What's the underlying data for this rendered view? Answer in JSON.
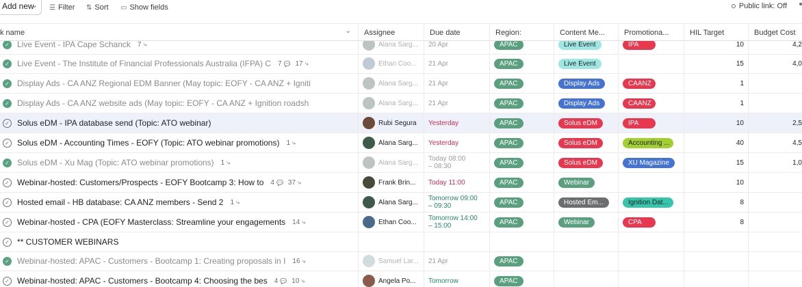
{
  "toolbar": {
    "add_new": "Add new",
    "filter": "Filter",
    "sort": "Sort",
    "show_fields": "Show fields",
    "public_link": "Public link: Off"
  },
  "columns": {
    "task_name": "k name",
    "assignee": "Assignee",
    "due_date": "Due date",
    "region": "Region:",
    "content": "Content Me...",
    "promotional": "Promotiona...",
    "hil": "HIL Target",
    "budget": "Budget Cost"
  },
  "rows": [
    {
      "name": "Live Event - IPA Cape Schanck",
      "done": true,
      "subtasks": "7",
      "comments": "",
      "assignee": "Alana Sarg...",
      "due": "20 Apr",
      "region": "APAC",
      "content": "Live Event",
      "promo": "IPA",
      "hil": "10",
      "budget": "4,2"
    },
    {
      "name": "Live Event - The Institute of Financial Professionals Australia (IFPA) C",
      "done": true,
      "comments": "7",
      "subtasks": "17",
      "assignee": "Ethan Coo...",
      "due": "21 Apr",
      "region": "APAC",
      "content": "Live Event",
      "promo": "",
      "hil": "15",
      "budget": "4,0"
    },
    {
      "name": "Display Ads - CA ANZ Regional EDM Banner (May topic: EOFY - CA ANZ + Igniti",
      "done": true,
      "comments": "",
      "subtasks": "",
      "assignee": "Alana Sarg...",
      "due": "21 Apr",
      "region": "APAC",
      "content": "Display Ads",
      "promo": "CAANZ",
      "hil": "1",
      "budget": ""
    },
    {
      "name": "Display Ads - CA ANZ website ads (May topic: EOFY - CA ANZ + Ignition roadsh",
      "done": true,
      "comments": "",
      "subtasks": "",
      "assignee": "Alana Sarg...",
      "due": "21 Apr",
      "region": "APAC",
      "content": "Display Ads",
      "promo": "CAANZ",
      "hil": "1",
      "budget": ""
    },
    {
      "name": "Solus eDM - IPA database send (Topic: ATO webinar)",
      "done": false,
      "comments": "",
      "subtasks": "",
      "assignee": "Rubi Segura",
      "due": "Yesterday",
      "region": "APAC",
      "content": "Solus eDM",
      "promo": "IPA",
      "hil": "10",
      "budget": "2,5"
    },
    {
      "name": "Solus eDM - Accounting Times - EOFY (Topic: ATO webinar promotions)",
      "done": false,
      "comments": "",
      "subtasks": "1",
      "assignee": "Alana Sarg...",
      "due": "Yesterday",
      "region": "APAC",
      "content": "Solus eDM",
      "promo": "Accounting ...",
      "hil": "40",
      "budget": "4,5"
    },
    {
      "name": "Solus eDM - Xu Mag (Topic: ATO webinar promotions)",
      "done": true,
      "comments": "",
      "subtasks": "1",
      "assignee": "Alana Sarg...",
      "due": "Today 08:00",
      "due2": "– 08:30",
      "region": "APAC",
      "content": "Solus eDM",
      "promo": "XU Magazine",
      "hil": "15",
      "budget": "1,0"
    },
    {
      "name": "Webinar-hosted: Customers/Prospects - EOFY Bootcamp 3: How to",
      "done": false,
      "comments": "4",
      "subtasks": "37",
      "assignee": "Frank Brin...",
      "due": "Today 11:00",
      "region": "APAC",
      "content": "Webinar",
      "promo": "",
      "hil": "10",
      "budget": ""
    },
    {
      "name": "Hosted email - HB database: CA ANZ members - Send 2",
      "done": false,
      "comments": "",
      "subtasks": "1",
      "assignee": "Alana Sarg...",
      "due": "Tomorrow 09:00",
      "due2": "– 09:30",
      "region": "APAC",
      "content": "Hosted Em...",
      "promo": "Ignition Dat...",
      "hil": "8",
      "budget": ""
    },
    {
      "name": "Webinar-hosted - CPA (EOFY Masterclass: Streamline your engagements",
      "done": false,
      "comments": "",
      "subtasks": "14",
      "assignee": "Ethan Coo...",
      "due": "Tomorrow 14:00",
      "due2": "– 15:00",
      "region": "APAC",
      "content": "Webinar",
      "promo": "CPA",
      "hil": "8",
      "budget": ""
    },
    {
      "name": "** CUSTOMER WEBINARS",
      "done": false,
      "comments": "",
      "subtasks": "",
      "assignee": "",
      "due": "",
      "region": "",
      "content": "",
      "promo": "",
      "hil": "",
      "budget": ""
    },
    {
      "name": "Webinar-hosted: APAC - Customers - Bootcamp 1: Creating proposals in I",
      "done": true,
      "comments": "",
      "subtasks": "16",
      "assignee": "Samuel Lar...",
      "due": "21 Apr",
      "region": "APAC",
      "content": "",
      "promo": "",
      "hil": "",
      "budget": ""
    },
    {
      "name": "Webinar-hosted: APAC - Customers - Bootcamp 4: Choosing the bes",
      "done": false,
      "comments": "4",
      "subtasks": "10",
      "assignee": "Angela Po...",
      "due": "Tomorrow",
      "region": "APAC",
      "content": "",
      "promo": "",
      "hil": "",
      "budget": ""
    }
  ],
  "colors": {
    "apac": "#5a9f7e",
    "solus": "#e8384f",
    "display": "#4573d2",
    "selected_row": "#eef0fa"
  }
}
